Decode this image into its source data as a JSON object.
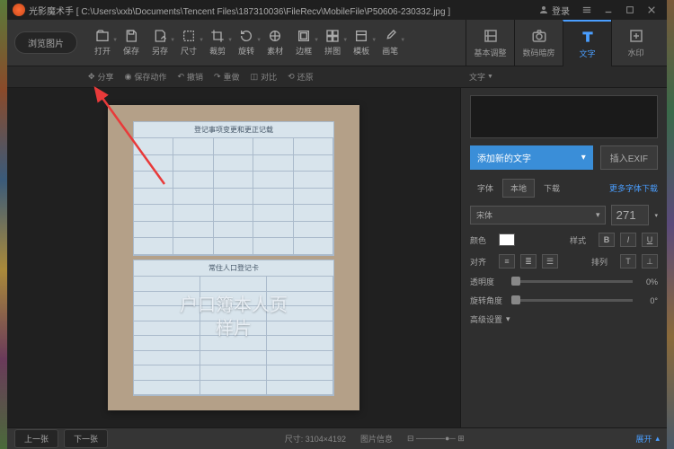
{
  "title": {
    "app": "光影魔术手",
    "path": "[ C:\\Users\\xxb\\Documents\\Tencent Files\\187310036\\FileRecv\\MobileFile\\P50606-230332.jpg ]"
  },
  "window": {
    "login": "登录"
  },
  "toolbar": {
    "browse": "浏览图片",
    "items": [
      "打开",
      "保存",
      "另存",
      "尺寸",
      "裁剪",
      "旋转",
      "素材",
      "边框",
      "拼图",
      "模板",
      "画笔"
    ]
  },
  "right_tabs": [
    "基本调整",
    "数码暗房",
    "文字",
    "水印"
  ],
  "subbar": {
    "share": "分享",
    "save_action": "保存动作",
    "undo": "撤销",
    "redo": "重做",
    "compare": "对比",
    "reset": "还原",
    "panel": "文字"
  },
  "image": {
    "page1_title": "登记事项变更和更正记载",
    "page2_title": "常住人口登记卡",
    "watermark_l1": "户口簿本人页",
    "watermark_l2": "样片"
  },
  "panel": {
    "add_text": "添加新的文字",
    "insert_exif": "插入EXIF",
    "font_tab": "字体",
    "local": "本地",
    "download": "下载",
    "more_fonts": "更多字体下载",
    "font_value": "宋体",
    "size_value": "271",
    "color": "颜色",
    "style": "样式",
    "align": "对齐",
    "arrange": "排列",
    "opacity": "透明度",
    "opacity_val": "0%",
    "rotate": "旋转角度",
    "rotate_val": "0°",
    "advanced": "高级设置"
  },
  "status": {
    "prev": "上一张",
    "next": "下一张",
    "dims": "尺寸: 3104×4192",
    "size": "图片信息",
    "zoom_label": "缩放",
    "open": "展开"
  }
}
